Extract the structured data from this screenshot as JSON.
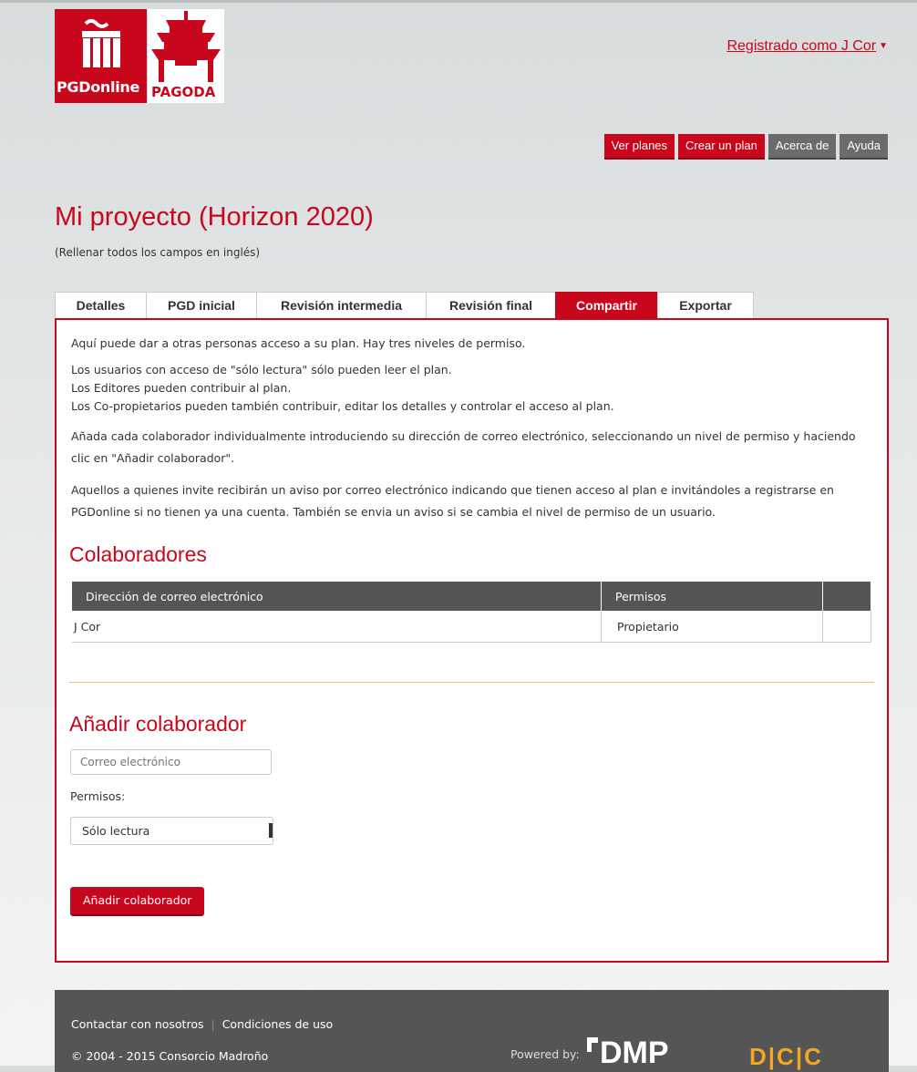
{
  "header": {
    "logo_text": "PGDonline",
    "pagoda_text": "PAGODA",
    "user_menu": "Registrado como J Cor"
  },
  "topnav": [
    {
      "label": "Ver planes"
    },
    {
      "label": "Crear un plan"
    },
    {
      "label": "Acerca de"
    },
    {
      "label": "Ayuda"
    }
  ],
  "page": {
    "title": "Mi proyecto (Horizon 2020)",
    "subtitle": "(Rellenar todos los campos en inglés)"
  },
  "tabs": [
    {
      "label": "Detalles"
    },
    {
      "label": "PGD inicial"
    },
    {
      "label": "Revisión intermedia"
    },
    {
      "label": "Revisión final"
    },
    {
      "label": "Compartir"
    },
    {
      "label": "Exportar"
    }
  ],
  "intro": {
    "p1": "Aquí puede dar a otras personas acceso a su plan. Hay tres niveles de permiso.",
    "p2a": "Los usuarios con acceso de \"sólo lectura\" sólo pueden leer el plan.",
    "p2b": "Los Editores pueden contribuir al plan.",
    "p2c": "Los Co-propietarios pueden también contribuir, editar los detalles y controlar el acceso al plan.",
    "p3": "Añada cada colaborador individualmente introduciendo su dirección de correo electrónico, seleccionando un nivel de permiso y haciendo clic en \"Añadir colaborador\".",
    "p4": "Aquellos a quienes invite recibirán un aviso por correo electrónico indicando que tienen acceso al plan e invitándoles a registrarse en PGDonline si no tienen ya una cuenta. También se envia un aviso si se cambia el nivel de permiso de un usuario."
  },
  "collaborators": {
    "heading": "Colaboradores",
    "columns": [
      "Dirección de correo electrónico",
      "Permisos",
      ""
    ],
    "rows": [
      {
        "email": "J Cor",
        "permission": "Propietario"
      }
    ]
  },
  "add_form": {
    "heading": "Añadir colaborador",
    "email_placeholder": "Correo electrónico",
    "permissions_label": "Permisos:",
    "permission_selected": "Sólo lectura",
    "submit_label": "Añadir colaborador"
  },
  "footer": {
    "contact": "Contactar con nosotros",
    "separator": "|",
    "terms": "Condiciones de uso",
    "copyright": "© 2004 - 2015 Consorcio Madroño",
    "powered_by": "Powered by:",
    "dmp_logo": "DMP",
    "dcc_logo": "D|C|C"
  },
  "colors": {
    "brand_red": "#c8071d",
    "grey_button": "#6b6b6b",
    "table_header": "#555555",
    "footer_bg": "#555555"
  }
}
